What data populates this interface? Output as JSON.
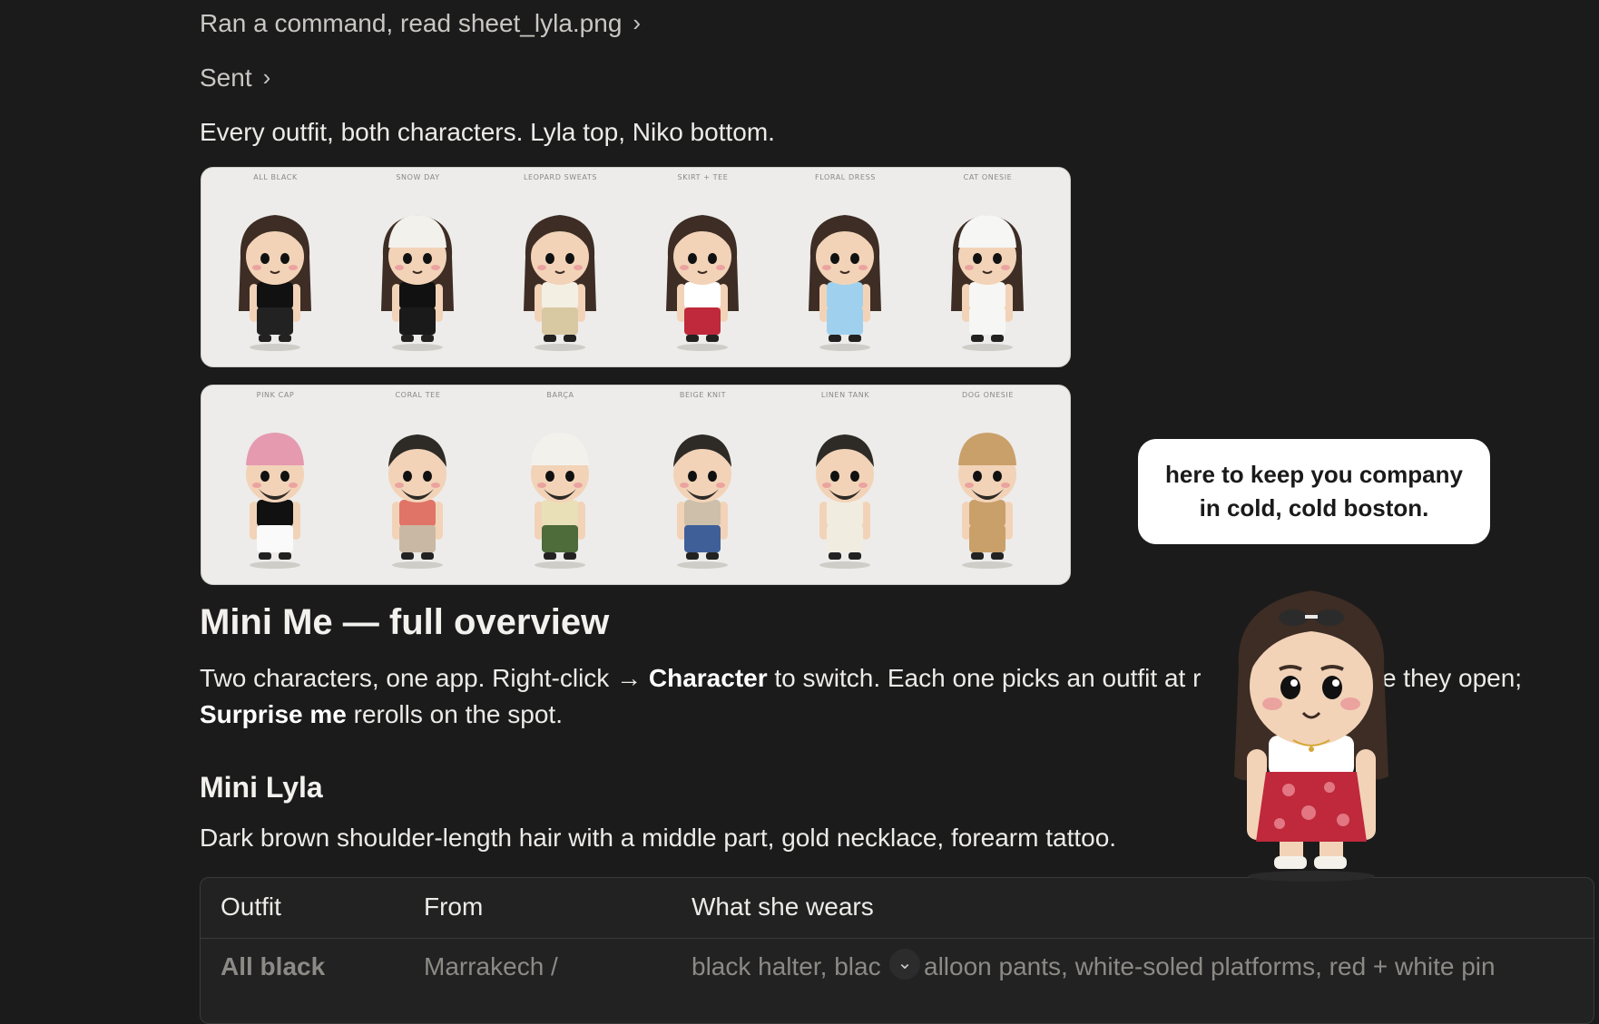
{
  "steps": {
    "ran_command": "Ran a command, read sheet_lyla.png",
    "sent": "Sent"
  },
  "message": "Every outfit, both characters. Lyla top, Niko bottom.",
  "sheet_lyla": {
    "outfits": [
      "ALL BLACK",
      "SNOW DAY",
      "LEOPARD SWEATS",
      "SKIRT + TEE",
      "FLORAL DRESS",
      "CAT ONESIE"
    ]
  },
  "sheet_niko": {
    "outfits": [
      "PINK CAP",
      "CORAL TEE",
      "BARÇA",
      "BEIGE KNIT",
      "LINEN TANK",
      "DOG ONESIE"
    ]
  },
  "overview": {
    "title": "Mini Me — full overview",
    "intro_1": "Two characters, one app. Right-click → ",
    "intro_bold_1": "Character",
    "intro_2": " to switch. Each one picks an outfit at r",
    "intro_3": "ime they open;",
    "intro_bold_2": "Surprise me",
    "intro_4": " rerolls on the spot."
  },
  "lyla": {
    "heading": "Mini Lyla",
    "description": "Dark brown shoulder-length hair with a middle part, gold necklace, forearm tattoo."
  },
  "table": {
    "headers": [
      "Outfit",
      "From",
      "What she wears"
    ],
    "rows": [
      [
        "All black",
        "Marrakech /",
        "black halter, blac",
        "alloon pants, white-soled platforms, red + white pin"
      ]
    ]
  },
  "companion": {
    "bubble_text": "here to keep you company in cold, cold boston."
  },
  "icons": {
    "chevron": "chevron-right-icon",
    "scroll": "chevron-down-icon"
  }
}
